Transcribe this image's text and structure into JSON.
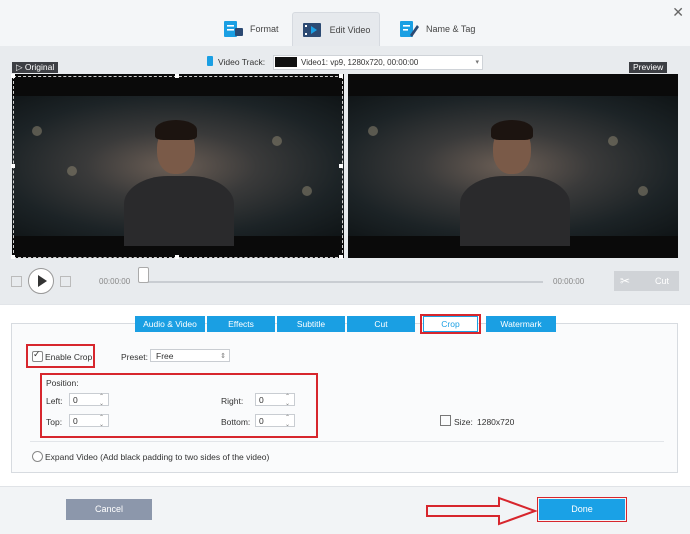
{
  "tabs": {
    "format": "Format",
    "edit_video": "Edit Video",
    "name_tag": "Name & Tag"
  },
  "close": "✕",
  "original_label": "Original",
  "preview_label": "Preview",
  "video_track": {
    "label": "Video Track:",
    "value": "Video1: vp9, 1280x720, 00:00:00"
  },
  "playback": {
    "time_start": "00:00:00",
    "time_end": "00:00:00",
    "cut_label": "Cut"
  },
  "edit_tabs": [
    "Audio & Video",
    "Effects",
    "Subtitle",
    "Cut",
    "Crop",
    "Watermark"
  ],
  "crop": {
    "enable_label": "Enable Crop",
    "preset_label": "Preset:",
    "preset_value": "Free",
    "position_label": "Position:",
    "left_label": "Left:",
    "left_value": "0",
    "top_label": "Top:",
    "top_value": "0",
    "right_label": "Right:",
    "right_value": "0",
    "bottom_label": "Bottom:",
    "bottom_value": "0",
    "size_label": "Size:",
    "size_value": "1280x720",
    "expand_label": "Expand Video (Add black padding to two sides of the video)"
  },
  "buttons": {
    "cancel": "Cancel",
    "done": "Done"
  },
  "colors": {
    "accent": "#1a9fe3",
    "annotation": "#d7262d"
  }
}
